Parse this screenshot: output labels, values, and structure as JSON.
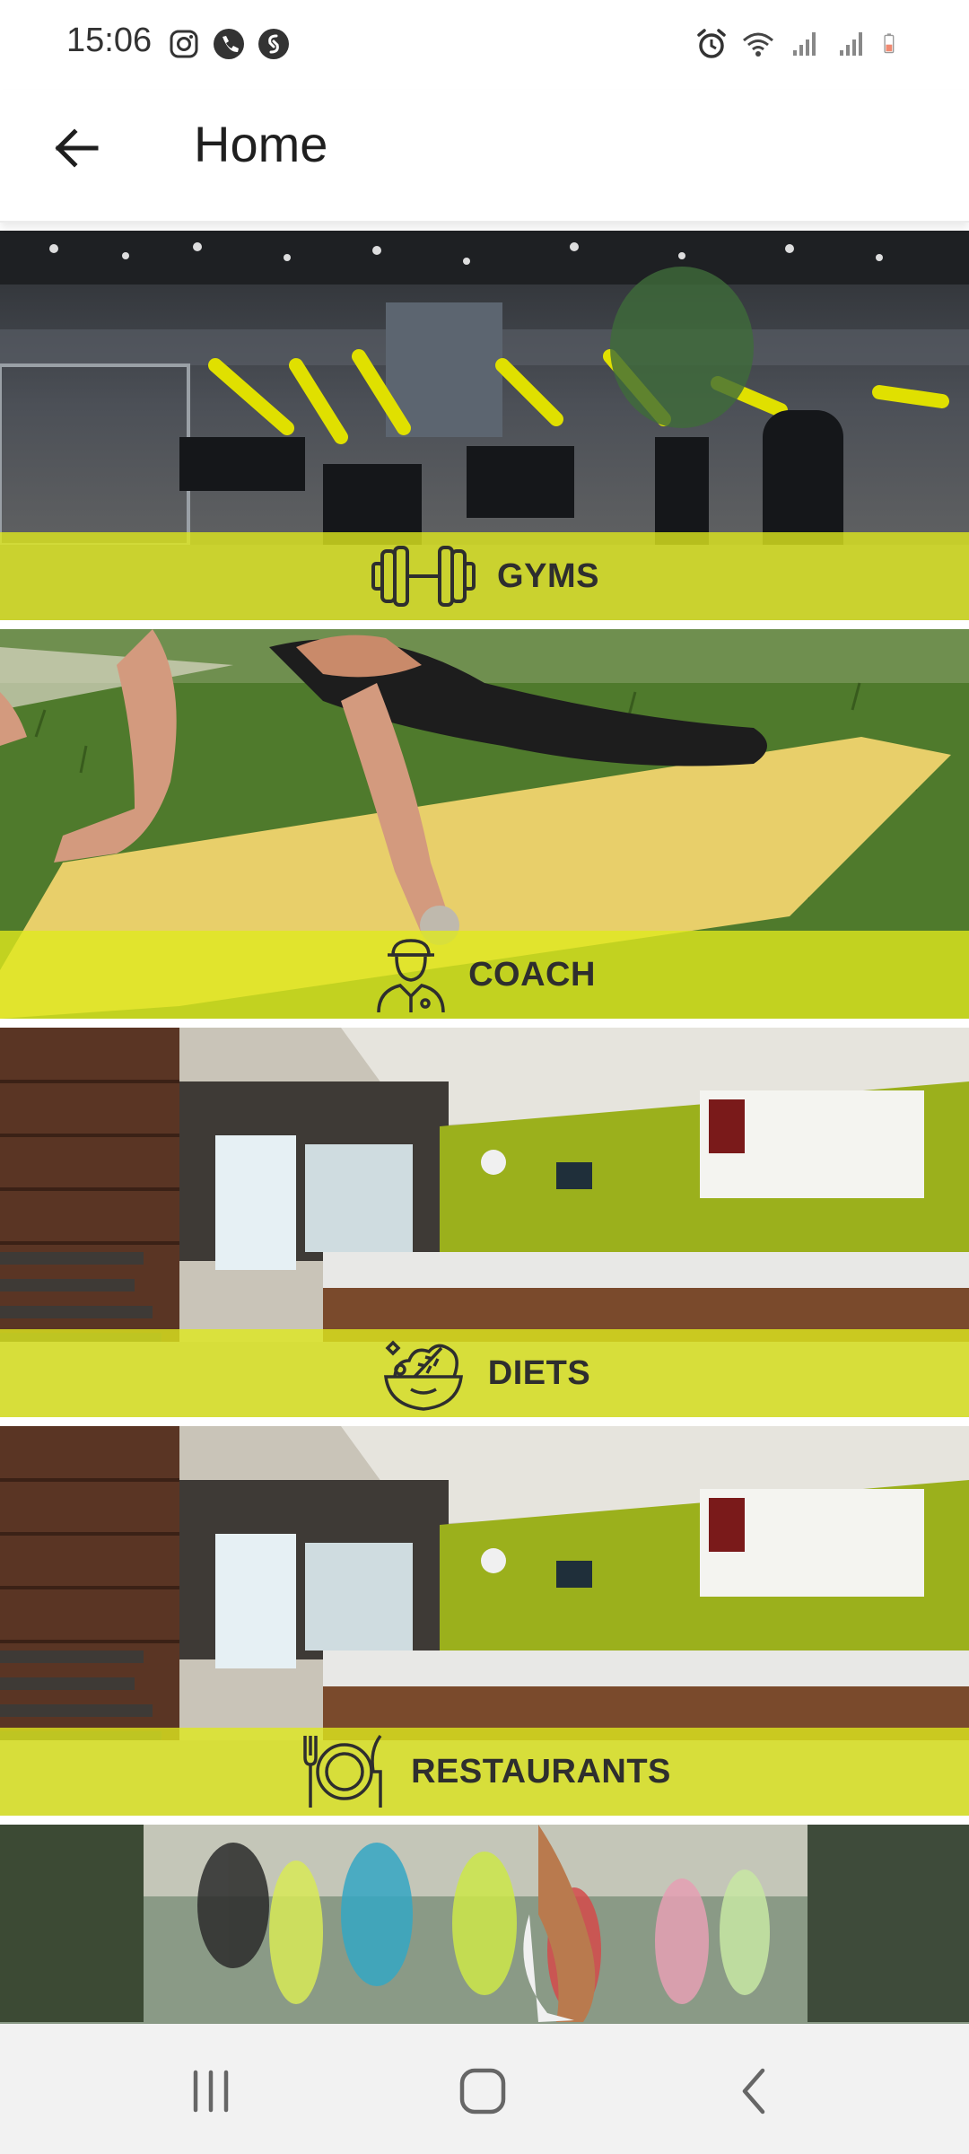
{
  "status_bar": {
    "time": "15:06",
    "left_icons": [
      "instagram-icon",
      "phone-icon",
      "shazam-icon"
    ],
    "right_icons": [
      "alarm-icon",
      "wifi-icon",
      "signal-icon",
      "signal-icon",
      "battery-low-icon"
    ]
  },
  "app_bar": {
    "title": "Home",
    "back_icon": "arrow-left-icon"
  },
  "categories": [
    {
      "label": "GYMS",
      "icon": "dumbbell-icon"
    },
    {
      "label": "COACH",
      "icon": "coach-icon"
    },
    {
      "label": "DIETS",
      "icon": "salad-bowl-icon"
    },
    {
      "label": "RESTAURANTS",
      "icon": "fork-plate-knife-icon"
    },
    {
      "label": "",
      "icon": ""
    }
  ],
  "colors": {
    "band": "#dee81e",
    "label_text": "#2e2e2e",
    "app_bar_bg": "#ffffff",
    "nav_bar_bg": "#f2f2f2"
  },
  "nav_bar": {
    "buttons": [
      "recents-icon",
      "home-icon",
      "back-icon"
    ]
  }
}
